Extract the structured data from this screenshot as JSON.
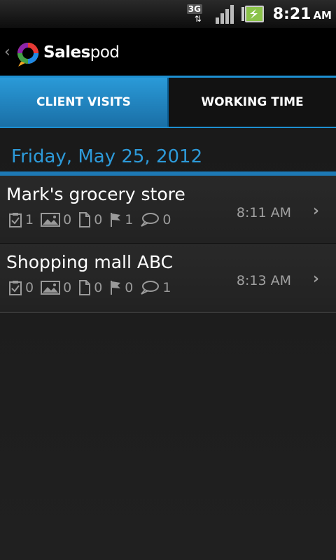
{
  "status_bar": {
    "network": "3G",
    "time": "8:21",
    "ampm": "AM"
  },
  "app": {
    "logo_bold": "Sales",
    "logo_light": "pod",
    "back_icon": "chevron-left-icon"
  },
  "tabs": [
    {
      "label": "CLIENT VISITS",
      "active": true
    },
    {
      "label": "WORKING TIME",
      "active": false
    }
  ],
  "date_header": "Friday, May 25, 2012",
  "visits": [
    {
      "name": "Mark's grocery store",
      "time": "8:11 AM",
      "tasks": "1",
      "photos": "0",
      "documents": "0",
      "flags": "1",
      "comments": "0"
    },
    {
      "name": "Shopping mall ABC",
      "time": "8:13 AM",
      "tasks": "0",
      "photos": "0",
      "documents": "0",
      "flags": "0",
      "comments": "1"
    }
  ],
  "colors": {
    "accent": "#1d8fd1",
    "date_text": "#2d9ad9"
  }
}
